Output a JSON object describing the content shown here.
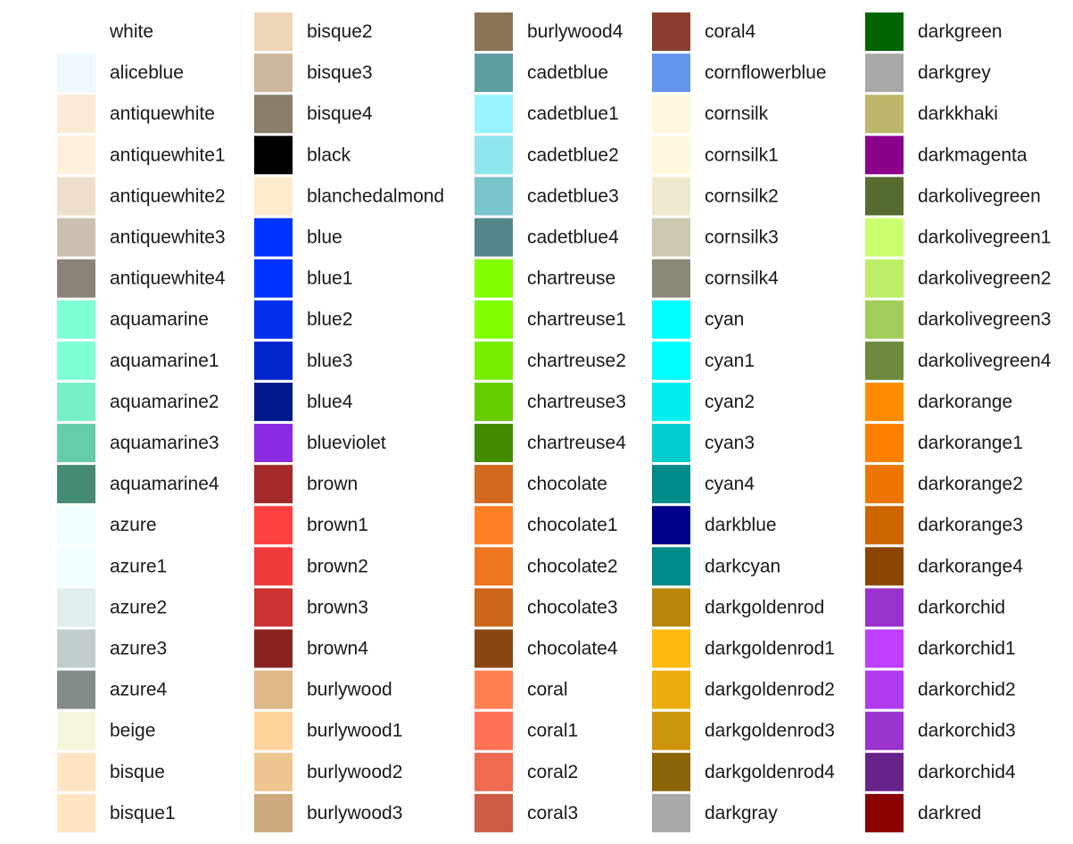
{
  "chart_data": {
    "type": "table",
    "columns": [
      [
        {
          "name": "white",
          "color": "#FFFFFF"
        },
        {
          "name": "aliceblue",
          "color": "#F0F8FF"
        },
        {
          "name": "antiquewhite",
          "color": "#FAEBD7"
        },
        {
          "name": "antiquewhite1",
          "color": "#FFEFDB"
        },
        {
          "name": "antiquewhite2",
          "color": "#EEDFCC"
        },
        {
          "name": "antiquewhite3",
          "color": "#CDC0B0"
        },
        {
          "name": "antiquewhite4",
          "color": "#8B8378"
        },
        {
          "name": "aquamarine",
          "color": "#7FFFD4"
        },
        {
          "name": "aquamarine1",
          "color": "#7FFFD4"
        },
        {
          "name": "aquamarine2",
          "color": "#76EEC6"
        },
        {
          "name": "aquamarine3",
          "color": "#66CDAA"
        },
        {
          "name": "aquamarine4",
          "color": "#458B74"
        },
        {
          "name": "azure",
          "color": "#F0FFFF"
        },
        {
          "name": "azure1",
          "color": "#F0FFFF"
        },
        {
          "name": "azure2",
          "color": "#E0EEEE"
        },
        {
          "name": "azure3",
          "color": "#C1CDCD"
        },
        {
          "name": "azure4",
          "color": "#838B8B"
        },
        {
          "name": "beige",
          "color": "#F5F5DC"
        },
        {
          "name": "bisque",
          "color": "#FFE4C4"
        },
        {
          "name": "bisque1",
          "color": "#FFE4C4"
        }
      ],
      [
        {
          "name": "bisque2",
          "color": "#EED5B7"
        },
        {
          "name": "bisque3",
          "color": "#CDB79E"
        },
        {
          "name": "bisque4",
          "color": "#8B7D6B"
        },
        {
          "name": "black",
          "color": "#000000"
        },
        {
          "name": "blanchedalmond",
          "color": "#FFEBCD"
        },
        {
          "name": "blue",
          "color": "#0033FF"
        },
        {
          "name": "blue1",
          "color": "#0033FF"
        },
        {
          "name": "blue2",
          "color": "#0030EE"
        },
        {
          "name": "blue3",
          "color": "#0027CD"
        },
        {
          "name": "blue4",
          "color": "#001A8B"
        },
        {
          "name": "blueviolet",
          "color": "#8A2BE2"
        },
        {
          "name": "brown",
          "color": "#A52A2A"
        },
        {
          "name": "brown1",
          "color": "#FF4040"
        },
        {
          "name": "brown2",
          "color": "#EE3B3B"
        },
        {
          "name": "brown3",
          "color": "#CD3333"
        },
        {
          "name": "brown4",
          "color": "#8B2323"
        },
        {
          "name": "burlywood",
          "color": "#DEB887"
        },
        {
          "name": "burlywood1",
          "color": "#FFD39B"
        },
        {
          "name": "burlywood2",
          "color": "#EEC591"
        },
        {
          "name": "burlywood3",
          "color": "#CDAA7D"
        }
      ],
      [
        {
          "name": "burlywood4",
          "color": "#8B7355"
        },
        {
          "name": "cadetblue",
          "color": "#5F9EA0"
        },
        {
          "name": "cadetblue1",
          "color": "#98F5FF"
        },
        {
          "name": "cadetblue2",
          "color": "#8EE5EE"
        },
        {
          "name": "cadetblue3",
          "color": "#7AC5CD"
        },
        {
          "name": "cadetblue4",
          "color": "#53868B"
        },
        {
          "name": "chartreuse",
          "color": "#7FFF00"
        },
        {
          "name": "chartreuse1",
          "color": "#7FFF00"
        },
        {
          "name": "chartreuse2",
          "color": "#76EE00"
        },
        {
          "name": "chartreuse3",
          "color": "#66CD00"
        },
        {
          "name": "chartreuse4",
          "color": "#458B00"
        },
        {
          "name": "chocolate",
          "color": "#D2691E"
        },
        {
          "name": "chocolate1",
          "color": "#FF7F24"
        },
        {
          "name": "chocolate2",
          "color": "#EE7621"
        },
        {
          "name": "chocolate3",
          "color": "#CD661D"
        },
        {
          "name": "chocolate4",
          "color": "#8B4513"
        },
        {
          "name": "coral",
          "color": "#FF7F50"
        },
        {
          "name": "coral1",
          "color": "#FF7256"
        },
        {
          "name": "coral2",
          "color": "#EE6A50"
        },
        {
          "name": "coral3",
          "color": "#CD5B45"
        }
      ],
      [
        {
          "name": "coral4",
          "color": "#8B3E2F"
        },
        {
          "name": "cornflowerblue",
          "color": "#6495ED"
        },
        {
          "name": "cornsilk",
          "color": "#FFF8DC"
        },
        {
          "name": "cornsilk1",
          "color": "#FFF8DC"
        },
        {
          "name": "cornsilk2",
          "color": "#EEE8CD"
        },
        {
          "name": "cornsilk3",
          "color": "#CDC8B1"
        },
        {
          "name": "cornsilk4",
          "color": "#8B8878"
        },
        {
          "name": "cyan",
          "color": "#00FFFF"
        },
        {
          "name": "cyan1",
          "color": "#00FFFF"
        },
        {
          "name": "cyan2",
          "color": "#00EEEE"
        },
        {
          "name": "cyan3",
          "color": "#00CDCD"
        },
        {
          "name": "cyan4",
          "color": "#008B8B"
        },
        {
          "name": "darkblue",
          "color": "#00008B"
        },
        {
          "name": "darkcyan",
          "color": "#008B8B"
        },
        {
          "name": "darkgoldenrod",
          "color": "#B8860B"
        },
        {
          "name": "darkgoldenrod1",
          "color": "#FFB90F"
        },
        {
          "name": "darkgoldenrod2",
          "color": "#EEAD0E"
        },
        {
          "name": "darkgoldenrod3",
          "color": "#CD950C"
        },
        {
          "name": "darkgoldenrod4",
          "color": "#8B6508"
        },
        {
          "name": "darkgray",
          "color": "#A9A9A9"
        }
      ],
      [
        {
          "name": "darkgreen",
          "color": "#006400"
        },
        {
          "name": "darkgrey",
          "color": "#A9A9A9"
        },
        {
          "name": "darkkhaki",
          "color": "#BDB76B"
        },
        {
          "name": "darkmagenta",
          "color": "#8B008B"
        },
        {
          "name": "darkolivegreen",
          "color": "#556B2F"
        },
        {
          "name": "darkolivegreen1",
          "color": "#CAFF70"
        },
        {
          "name": "darkolivegreen2",
          "color": "#BCEE68"
        },
        {
          "name": "darkolivegreen3",
          "color": "#A2CD5A"
        },
        {
          "name": "darkolivegreen4",
          "color": "#6E8B3D"
        },
        {
          "name": "darkorange",
          "color": "#FF8C00"
        },
        {
          "name": "darkorange1",
          "color": "#FF7F00"
        },
        {
          "name": "darkorange2",
          "color": "#EE7600"
        },
        {
          "name": "darkorange3",
          "color": "#CD6600"
        },
        {
          "name": "darkorange4",
          "color": "#8B4500"
        },
        {
          "name": "darkorchid",
          "color": "#9932CC"
        },
        {
          "name": "darkorchid1",
          "color": "#BF3EFF"
        },
        {
          "name": "darkorchid2",
          "color": "#B23AEE"
        },
        {
          "name": "darkorchid3",
          "color": "#9A32CD"
        },
        {
          "name": "darkorchid4",
          "color": "#68228B"
        },
        {
          "name": "darkred",
          "color": "#8B0000"
        }
      ]
    ]
  }
}
